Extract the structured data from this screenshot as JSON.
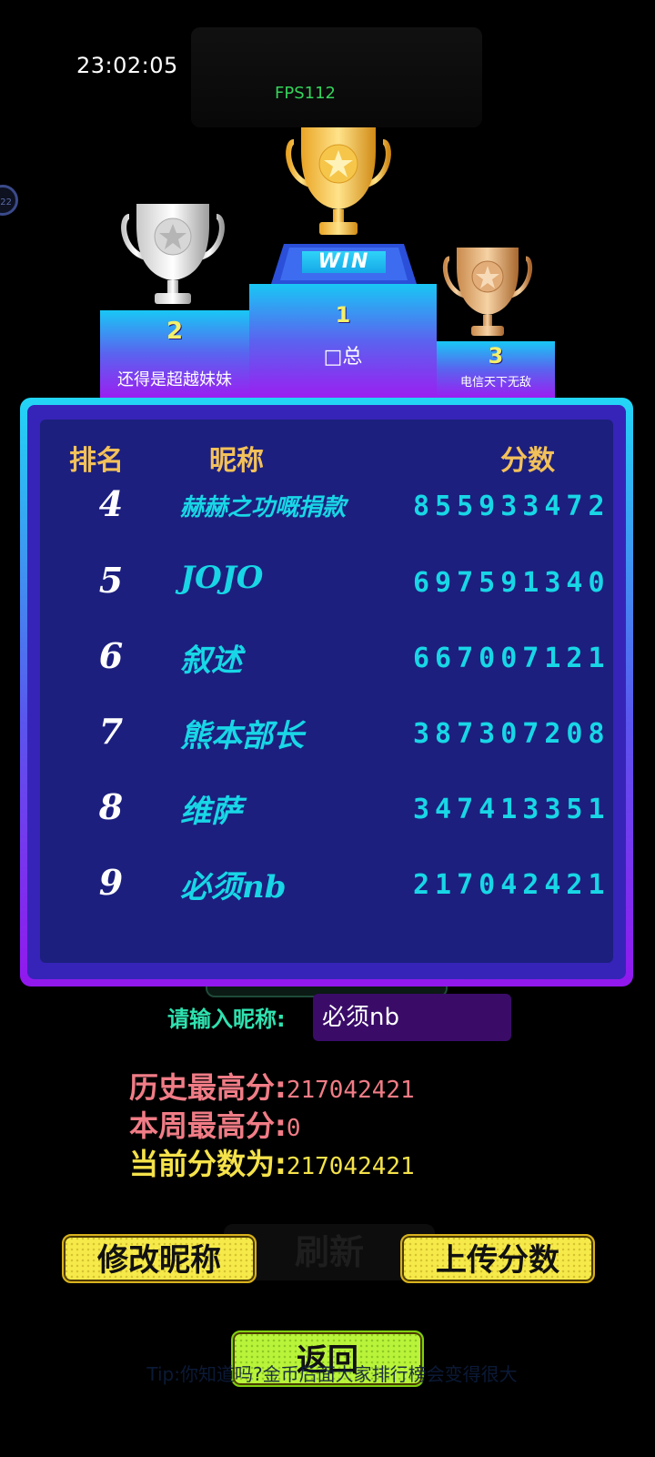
{
  "status": {
    "clock": "23:02:05",
    "fps": "FPS112",
    "side_badge": "22"
  },
  "podium": {
    "first": {
      "rank": "1",
      "name": "□总",
      "badge": "WIN"
    },
    "second": {
      "rank": "2",
      "name": "还得是超越妹妹"
    },
    "third": {
      "rank": "3",
      "name": "电信天下无敌"
    }
  },
  "board": {
    "headers": {
      "rank": "排名",
      "nickname": "昵称",
      "score": "分数"
    },
    "rows": [
      {
        "rank": "4",
        "nickname": "赫赫之功嘅捐款",
        "score": "855933472"
      },
      {
        "rank": "5",
        "nickname": "JOJO",
        "score": "697591340"
      },
      {
        "rank": "6",
        "nickname": "叙述",
        "score": "667007121"
      },
      {
        "rank": "7",
        "nickname": "熊本部长",
        "score": "387307208"
      },
      {
        "rank": "8",
        "nickname": "维萨",
        "score": "347413351"
      },
      {
        "rank": "9",
        "nickname": "必须nb",
        "score": "217042421"
      }
    ]
  },
  "input": {
    "label": "请输入昵称:",
    "value": "必须nb"
  },
  "stats": {
    "history_label": "历史最高分:",
    "history_value": "217042421",
    "week_label": "本周最高分:",
    "week_value": "0",
    "current_label": "当前分数为:",
    "current_value": "217042421"
  },
  "buttons": {
    "rename": "修改昵称",
    "upload": "上传分数",
    "refresh": "刷新",
    "back": "返回"
  },
  "tip": "Tip:你知道吗?金币后面大家排行榜会变得很大",
  "colors": {
    "accent_cyan": "#18d6e6",
    "gold": "#f3c15a",
    "history": "#f07c86",
    "week": "#f07c86",
    "current": "#f5e24a",
    "button_yellow": "#f6ea4a",
    "button_green": "#b9f43a"
  }
}
